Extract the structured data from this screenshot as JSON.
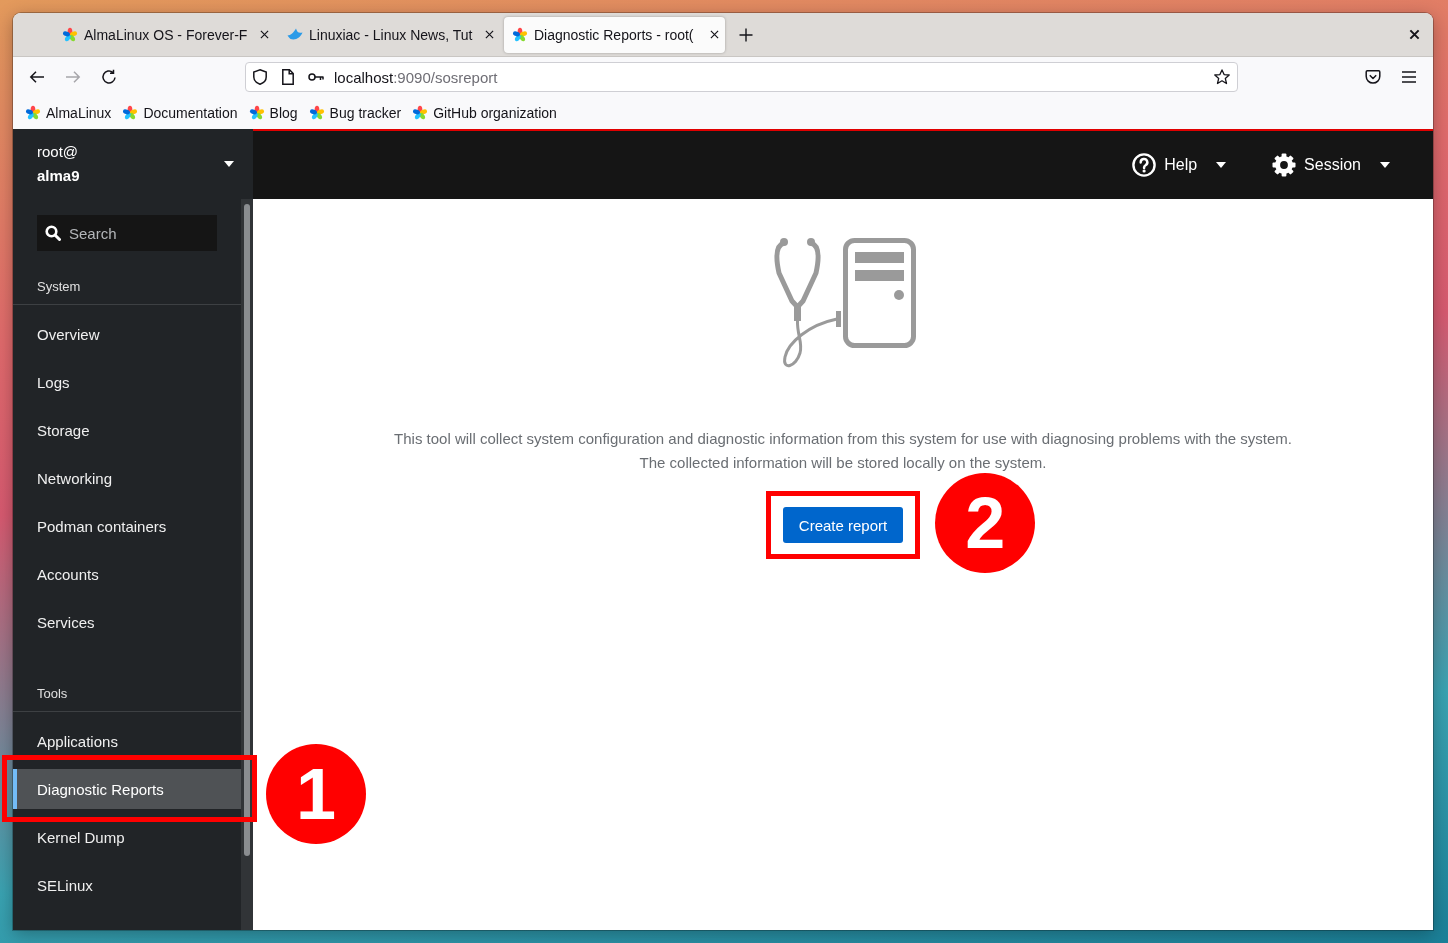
{
  "browser": {
    "tabs": [
      {
        "title": "AlmaLinux OS - Forever-F",
        "kind": "flower",
        "selected": false
      },
      {
        "title": "Linuxiac - Linux News, Tut",
        "kind": "bird",
        "selected": false
      },
      {
        "title": "Diagnostic Reports - root(",
        "kind": "flower",
        "selected": true
      }
    ],
    "forward": {
      "disabled": true
    },
    "address": {
      "host": "localhost",
      "path": ":9090/sosreport"
    },
    "bookmarks": [
      {
        "label": "AlmaLinux"
      },
      {
        "label": "Documentation"
      },
      {
        "label": "Blog"
      },
      {
        "label": "Bug tracker"
      },
      {
        "label": "GitHub organization"
      }
    ]
  },
  "sidebar": {
    "user": "root@",
    "host": "alma9",
    "search": {
      "placeholder": "Search"
    },
    "sections": [
      {
        "title": "System",
        "items": [
          {
            "label": "Overview",
            "selected": false
          },
          {
            "label": "Logs",
            "selected": false
          },
          {
            "label": "Storage",
            "selected": false
          },
          {
            "label": "Networking",
            "selected": false
          },
          {
            "label": "Podman containers",
            "selected": false
          },
          {
            "label": "Accounts",
            "selected": false
          },
          {
            "label": "Services",
            "selected": false
          }
        ]
      },
      {
        "title": "Tools",
        "items": [
          {
            "label": "Applications",
            "selected": false
          },
          {
            "label": "Diagnostic Reports",
            "selected": true,
            "callout": "1"
          },
          {
            "label": "Kernel Dump",
            "selected": false
          },
          {
            "label": "SELinux",
            "selected": false
          }
        ]
      }
    ]
  },
  "masthead": {
    "menus": [
      {
        "kind": "help",
        "label": "Help"
      },
      {
        "kind": "session",
        "label": "Session"
      }
    ]
  },
  "main": {
    "description": [
      "This tool will collect system configuration and diagnostic information from this system for use with diagnosing problems with the system.",
      "The collected information will be stored locally on the system."
    ],
    "button": {
      "label": "Create report",
      "callout": "2"
    }
  }
}
